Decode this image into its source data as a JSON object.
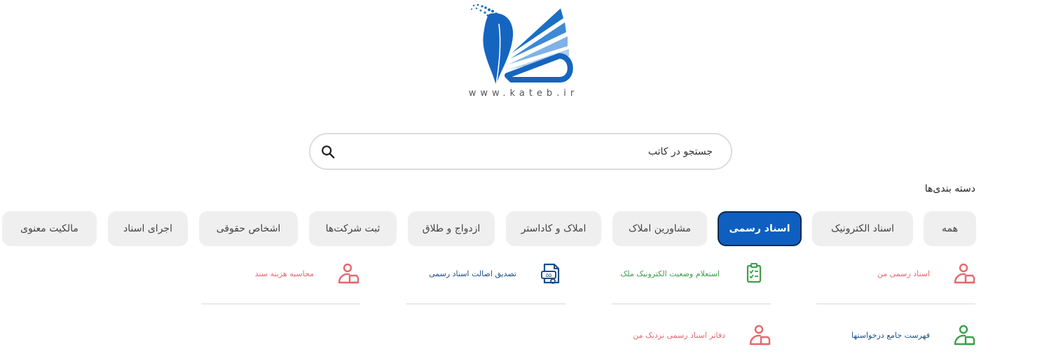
{
  "logo": {
    "caption": "www.kateb.ir"
  },
  "search": {
    "placeholder": "جستجو در کاتب"
  },
  "categories": {
    "heading": "دسته بندی‌ها",
    "tabs": [
      {
        "label": "همه"
      },
      {
        "label": "اسناد الکترونیک"
      },
      {
        "label": "اسناد رسمی",
        "active": true
      },
      {
        "label": "مشاورین املاک"
      },
      {
        "label": "املاک و کاداستر"
      },
      {
        "label": "ازدواج و طلاق"
      },
      {
        "label": "ثبت شرکت‌ها"
      },
      {
        "label": "اشخاص حقوقی"
      },
      {
        "label": "اجرای اسناد"
      },
      {
        "label": "مالکیت معنوی"
      }
    ]
  },
  "services": [
    {
      "label": "اسناد رسمی من",
      "icon": "person-document-icon",
      "color": "#e8676b"
    },
    {
      "label": "استعلام وضعیت الکترونیک ملک",
      "icon": "clipboard-check-icon",
      "color": "#3aa04a"
    },
    {
      "label": "تصدیق اصالت اسناد رسمی",
      "icon": "document-seal-icon",
      "color": "#1b4f8a"
    },
    {
      "label": "محاسبه هزینه سند",
      "icon": "person-document-icon",
      "color": "#e8676b"
    },
    {
      "label": "فهرست جامع درخواستها",
      "icon": "person-document-icon",
      "color": "#3aa04a"
    },
    {
      "label": "دفاتر اسناد رسمی نزدیک من",
      "icon": "person-document-icon",
      "color": "#e8676b"
    }
  ],
  "colors": {
    "accent": "#0e5fbf",
    "tab_bg": "#efefef"
  }
}
